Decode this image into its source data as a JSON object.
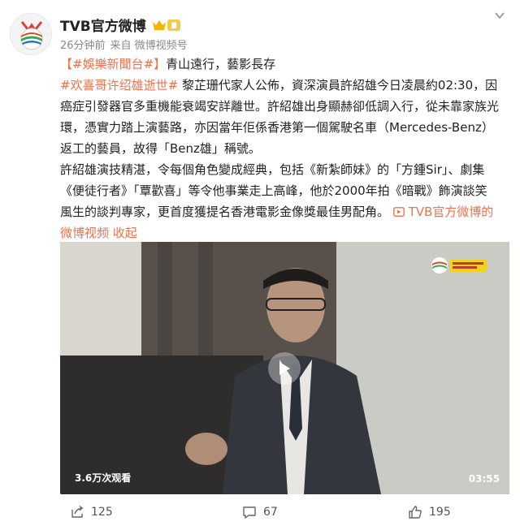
{
  "author": {
    "name": "TVB官方微博",
    "time": "26分钟前",
    "source": "来自 微博视频号"
  },
  "post": {
    "tag1": "【#娛樂新聞台#】",
    "headline": "青山遠行，藝影長存",
    "tag2": "#欢喜哥许绍雄逝世#",
    "para1_a": " 黎芷珊代家人公佈，資深演員許紹雄今日凌晨約02:30，因",
    "para1_b": "癌症引發器官多重機能衰竭安詳離世。許紹雄出身顯赫卻低調入行，從未靠家族光",
    "para1_c": "環，憑實力踏上演藝路，亦因當年佢係香港第一個駕駛名車（Mercedes-Benz）",
    "para1_d": "返工的藝員，故得「Benz雄」稱號。",
    "para2_a": "許紹雄演技精湛，令每個角色變成經典，包括《新紮師妹》的「方鍾Sir」、劇集",
    "para2_b": "《便徒行者》「覃歡喜」等令他事業走上高峰，他於2000年拍《暗戰》飾演談笑",
    "para2_c": "風生的談判專家，更首度獲提名香港電影金像獎最佳男配角。",
    "video_link": "TVB官方微博的",
    "video_link_2": "微博视频",
    "collapse": "收起"
  },
  "video": {
    "views": "3.6万次观看",
    "duration": "03:55"
  },
  "actions": {
    "share_count": "125",
    "comment_count": "67",
    "like_count": "195"
  },
  "colors": {
    "link": "#eb7350",
    "text": "#222222",
    "meta": "#8a8a8a"
  }
}
